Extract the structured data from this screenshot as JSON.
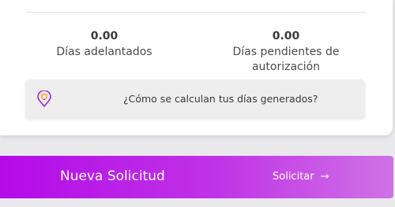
{
  "stats": {
    "advanced": {
      "value": "0.00",
      "label": "Días adelantados"
    },
    "pending": {
      "value": "0.00",
      "label_line1": "Días pendientes de",
      "label_line2": "autorización"
    }
  },
  "info": {
    "text": "¿Cómo se calculan tus días generados?",
    "icon": "lightbulb-pin-icon"
  },
  "banner": {
    "title": "Nueva Solicitud",
    "action_label": "Solicitar",
    "action_icon": "→"
  },
  "colors": {
    "accent": "#b40ae8",
    "accent_light": "#cf72e6",
    "icon_primary": "#9b2ecf",
    "icon_secondary": "#f0a020"
  }
}
